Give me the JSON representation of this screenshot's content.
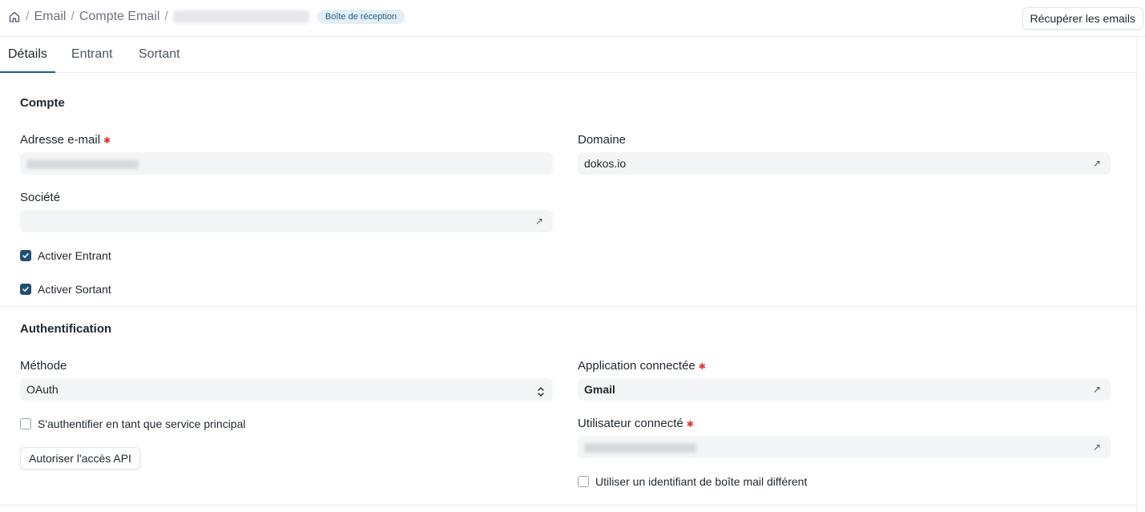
{
  "breadcrumb": {
    "items": [
      "Email",
      "Compte Email"
    ],
    "badge": "Boîte de réception"
  },
  "header": {
    "fetch_button": "Récupérer les emails"
  },
  "tabs": [
    {
      "label": "Détails",
      "active": true
    },
    {
      "label": "Entrant",
      "active": false
    },
    {
      "label": "Sortant",
      "active": false
    }
  ],
  "account": {
    "title": "Compte",
    "email_label": "Adresse e-mail",
    "domain_label": "Domaine",
    "domain_value": "dokos.io",
    "company_label": "Société",
    "enable_incoming": "Activer Entrant",
    "enable_outgoing": "Activer Sortant"
  },
  "auth": {
    "title": "Authentification",
    "method_label": "Méthode",
    "method_value": "OAuth",
    "connected_app_label": "Application connectée",
    "connected_app_value": "Gmail",
    "service_principal": "S'authentifier en tant que service principal",
    "connected_user_label": "Utilisateur connecté",
    "authorize_button": "Autoriser l'accès API",
    "different_login": "Utiliser un identifiant de boîte mail différent"
  },
  "colors": {
    "accent": "#1f5f86",
    "checkbox": "#1f4f73",
    "required": "#e03636",
    "field_bg": "#f4f5f6"
  }
}
